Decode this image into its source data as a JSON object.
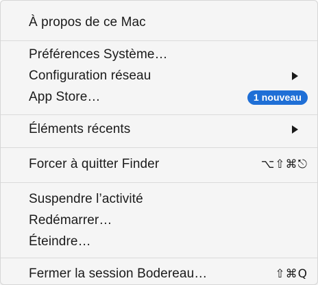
{
  "menu": {
    "about": "À propos de ce Mac",
    "system_prefs": "Préférences Système…",
    "network_config": "Configuration réseau",
    "app_store": "App Store…",
    "app_store_badge": "1 nouveau",
    "recent_items": "Éléments récents",
    "force_quit": "Forcer à quitter Finder",
    "force_quit_shortcut": "⌥⇧⌘⎋",
    "sleep": "Suspendre l’activité",
    "restart": "Redémarrer…",
    "shutdown": "Éteindre…",
    "logout": "Fermer la session Bodereau…",
    "logout_shortcut": "⇧⌘Q"
  },
  "colors": {
    "badge": "#1f6fd6",
    "menu_background": "#f5f5f5",
    "separator": "#dadada"
  }
}
